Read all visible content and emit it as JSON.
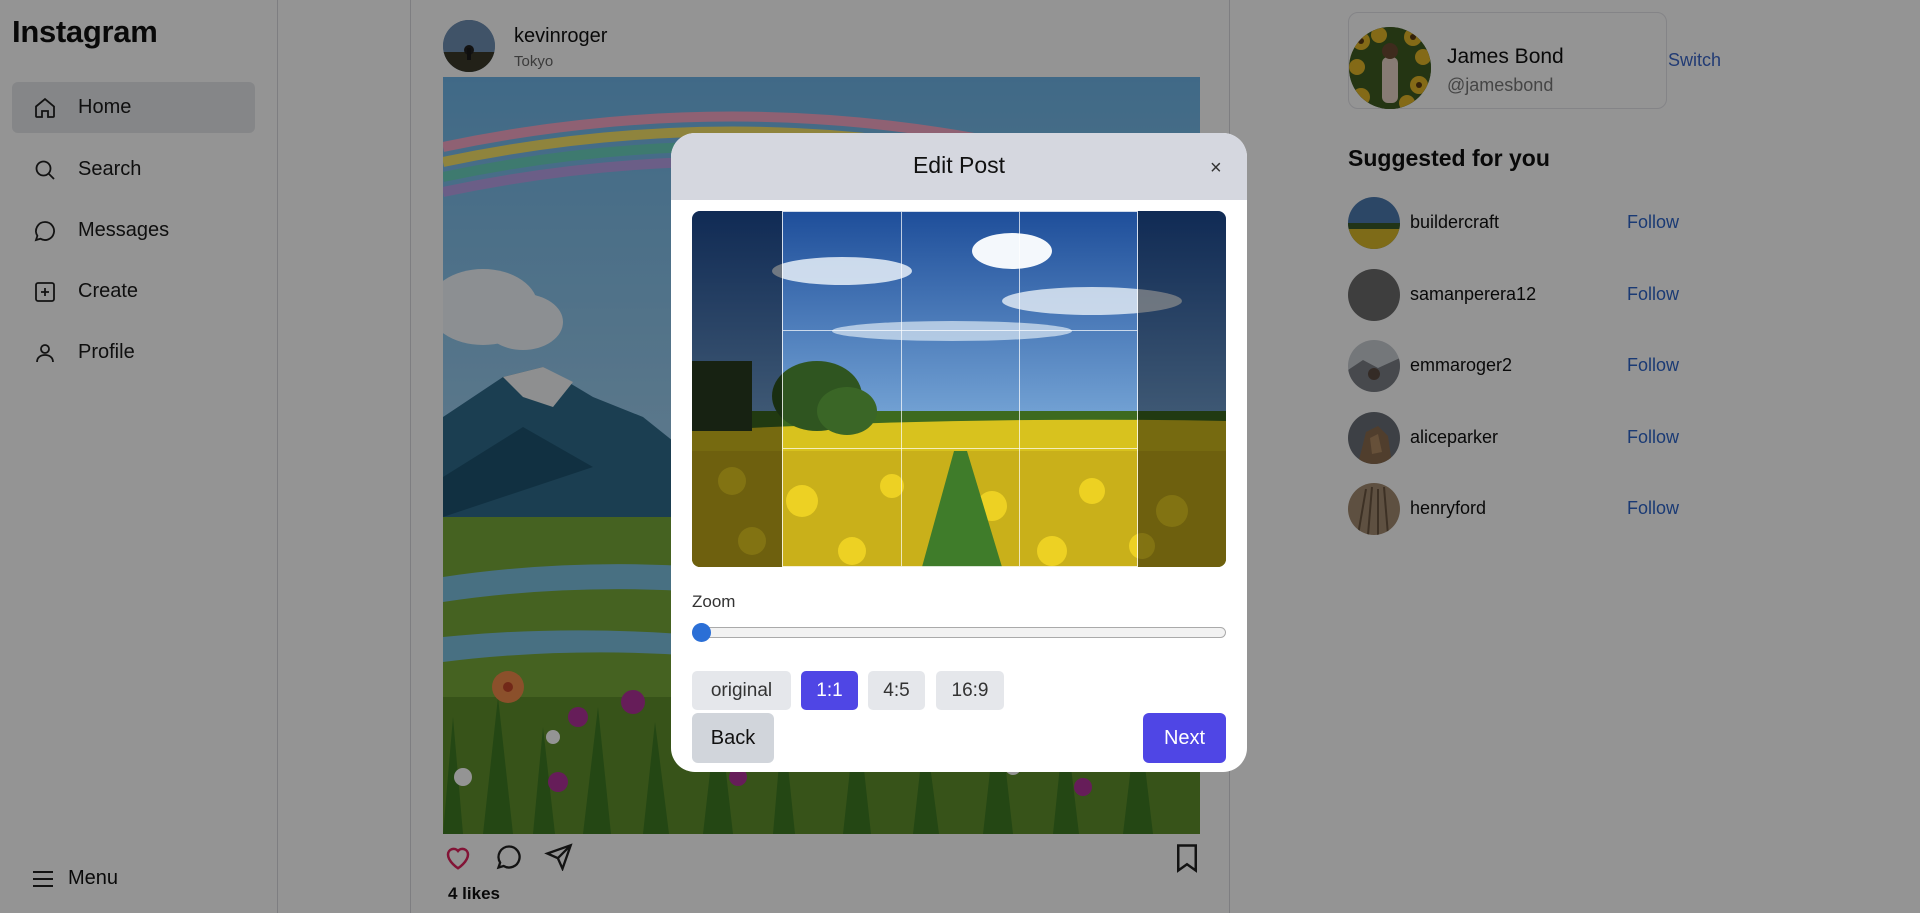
{
  "app": {
    "logo": "Instagram"
  },
  "sidebar": {
    "items": [
      {
        "label": "Home",
        "icon": "home-icon",
        "active": true
      },
      {
        "label": "Search",
        "icon": "search-icon"
      },
      {
        "label": "Messages",
        "icon": "message-icon"
      },
      {
        "label": "Create",
        "icon": "plus-square-icon"
      },
      {
        "label": "Profile",
        "icon": "user-icon"
      }
    ],
    "menu_label": "Menu"
  },
  "post": {
    "username": "kevinroger",
    "location": "Tokyo",
    "likes": "4 likes"
  },
  "account": {
    "name": "James Bond",
    "handle": "@jamesbond",
    "switch_label": "Switch"
  },
  "suggestions": {
    "title": "Suggested for you",
    "follow_label": "Follow",
    "users": [
      "buildercraft",
      "samanperera12",
      "emmaroger2",
      "aliceparker",
      "henryford"
    ]
  },
  "modal": {
    "title": "Edit Post",
    "close_label": "×",
    "zoom_label": "Zoom",
    "zoom_value": 0,
    "ratios": [
      "original",
      "1:1",
      "4:5",
      "16:9"
    ],
    "selected_ratio": "1:1",
    "back_label": "Back",
    "next_label": "Next"
  },
  "colors": {
    "accent": "#4f46e5",
    "link": "#3b67c9",
    "like": "#e0245e"
  }
}
